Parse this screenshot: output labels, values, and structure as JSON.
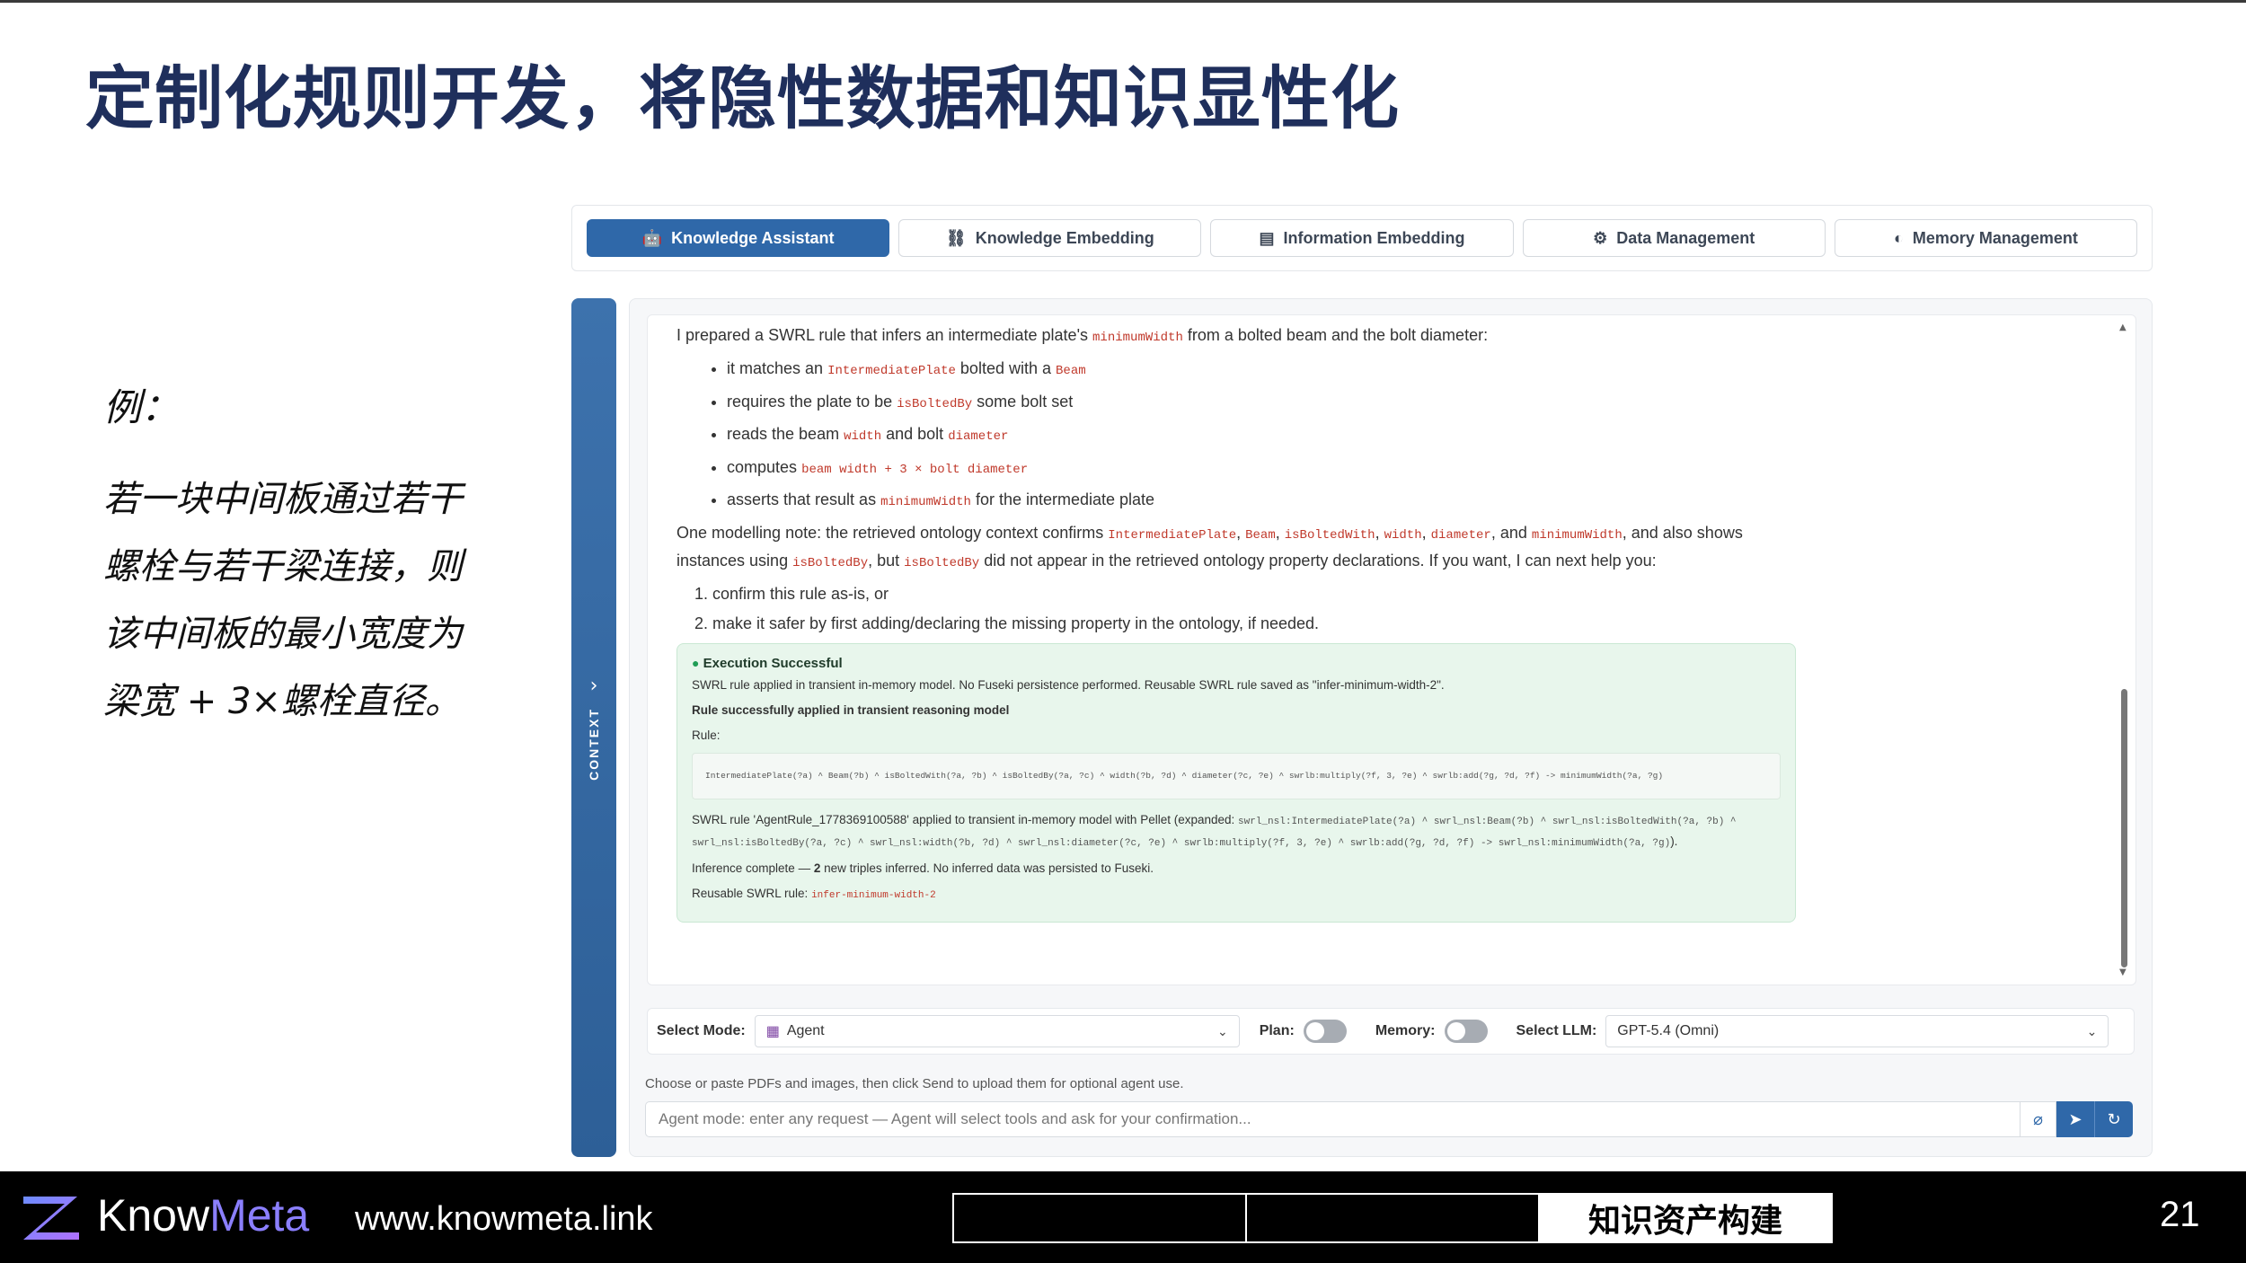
{
  "slide": {
    "title": "定制化规则开发，将隐性数据和知识显性化",
    "example_label": "例：",
    "example_lines": [
      "若一块中间板通过若干",
      "螺栓与若干梁连接，则",
      "该中间板的最小宽度为",
      "梁宽 + 3×螺栓直径。"
    ]
  },
  "tabs": [
    {
      "label": "Knowledge Assistant",
      "icon": "robot-icon",
      "active": true
    },
    {
      "label": "Knowledge Embedding",
      "icon": "network-icon",
      "active": false
    },
    {
      "label": "Information Embedding",
      "icon": "document-icon",
      "active": false
    },
    {
      "label": "Data Management",
      "icon": "gear-icon",
      "active": false
    },
    {
      "label": "Memory Management",
      "icon": "brain-icon",
      "active": false
    }
  ],
  "context_rail": {
    "label": "CONTEXT"
  },
  "message": {
    "intro_a": "I prepared a SWRL rule that infers an intermediate plate's",
    "intro_code": "minimumWidth",
    "intro_b": "from a bolted beam and the bolt diameter:",
    "bullets": [
      {
        "a": "it matches an",
        "c1": "IntermediatePlate",
        "b": "bolted with a",
        "c2": "Beam",
        "d": ""
      },
      {
        "a": "requires the plate to be",
        "c1": "isBoltedBy",
        "b": "some bolt set",
        "c2": "",
        "d": ""
      },
      {
        "a": "reads the beam",
        "c1": "width",
        "b": "and bolt",
        "c2": "diameter",
        "d": ""
      },
      {
        "a": "computes",
        "c1": "beam width + 3 × bolt diameter",
        "b": "",
        "c2": "",
        "d": ""
      },
      {
        "a": "asserts that result as",
        "c1": "minimumWidth",
        "b": "for the intermediate plate",
        "c2": "",
        "d": ""
      }
    ],
    "note_a": "One modelling note: the retrieved ontology context confirms",
    "note_codes": [
      "IntermediatePlate",
      "Beam",
      "isBoltedWith",
      "width",
      "diameter"
    ],
    "note_and": "and",
    "note_last_code": "minimumWidth",
    "note_b": ", and also shows instances using",
    "note_code2": "isBoltedBy",
    "note_c": ", but",
    "note_code3": "isBoltedBy",
    "note_d": "did not appear in the retrieved ontology property declarations. If you want, I can next help you:",
    "options": [
      "confirm this rule as-is, or",
      "make it safer by first adding/declaring the missing property in the ontology, if needed."
    ]
  },
  "execution": {
    "status": "Execution Successful",
    "line1": "SWRL rule applied in transient in-memory model. No Fuseki persistence performed. Reusable SWRL rule saved as \"infer-minimum-width-2\".",
    "line2": "Rule successfully applied in transient reasoning model",
    "rule_label": "Rule:",
    "rule_text": "IntermediatePlate(?a) ^ Beam(?b) ^ isBoltedWith(?a, ?b) ^ isBoltedBy(?a, ?c) ^ width(?b, ?d) ^ diameter(?c, ?e) ^ swrlb:multiply(?f, 3, ?e) ^ swrlb:add(?g, ?d, ?f) -> minimumWidth(?a, ?g)",
    "detail_a": "SWRL rule 'AgentRule_1778369100588' applied to transient in-memory model with Pellet (expanded:",
    "detail_code": "swrl_nsl:IntermediatePlate(?a) ^ swrl_nsl:Beam(?b) ^ swrl_nsl:isBoltedWith(?a, ?b) ^ swrl_nsl:isBoltedBy(?a, ?c) ^ swrl_nsl:width(?b, ?d) ^ swrl_nsl:diameter(?c, ?e) ^ swrlb:multiply(?f, 3, ?e) ^ swrlb:add(?g, ?d, ?f) -> swrl_nsl:minimumWidth(?a, ?g)",
    "detail_b": ").",
    "inference_a": "Inference complete —",
    "inference_count": "2",
    "inference_b": "new triples inferred. No inferred data was persisted to Fuseki.",
    "reusable_label": "Reusable SWRL rule:",
    "reusable_name": "infer-minimum-width-2"
  },
  "controls": {
    "mode_label": "Select Mode:",
    "mode_value": "Agent",
    "plan_label": "Plan:",
    "plan_on": false,
    "memory_label": "Memory:",
    "memory_on": false,
    "llm_label": "Select LLM:",
    "llm_value": "GPT-5.4 (Omni)"
  },
  "upload_hint": "Choose or paste PDFs and images, then click Send to upload them for optional agent use.",
  "input": {
    "placeholder": "Agent mode: enter any request — Agent will select tools and ask for your confirmation..."
  },
  "footer": {
    "brand_a": "Know",
    "brand_b": "Meta",
    "website": "www.knowmeta.link",
    "section": "知识资产构建",
    "page": "21"
  },
  "colors": {
    "accent": "#2f68a9",
    "title": "#1f2f5c",
    "success_bg": "#e8f6ec",
    "code": "#c0392b",
    "brand_meta": "#8b7fff"
  }
}
